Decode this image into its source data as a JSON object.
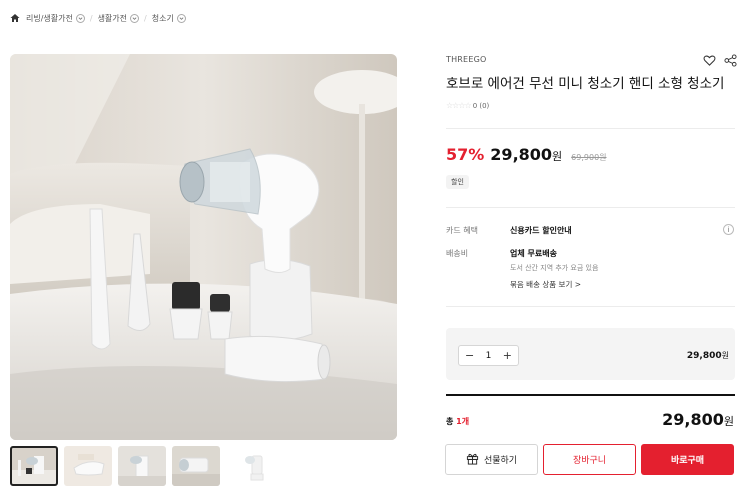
{
  "breadcrumb": {
    "items": [
      "리빙/생활가전",
      "생활가전",
      "청소기"
    ]
  },
  "product": {
    "brand": "THREEGO",
    "title": "호브로 에어건 무선 미니 청소기 핸디 소형 청소기",
    "rating_stars": "☆☆☆☆",
    "rating_text": "0 (0)",
    "discount": "57%",
    "price": "29,800",
    "currency": "원",
    "original_price": "69,900원",
    "sale_badge": "할인"
  },
  "info": {
    "card_label": "카드 혜택",
    "card_value": "신용카드 할인안내",
    "shipping_label": "배송비",
    "shipping_value": "업체 무료배송",
    "shipping_note": "도서 산간 지역 추가 요금 있음",
    "bundle_link": "묶음 배송 상품 보기 >"
  },
  "option": {
    "minus": "−",
    "qty": "1",
    "plus": "+",
    "price": "29,800",
    "currency": "원"
  },
  "total": {
    "prefix": "총 ",
    "count": "1개",
    "price": "29,800",
    "currency": "원"
  },
  "buttons": {
    "gift": "선물하기",
    "cart": "장바구니",
    "buy": "바로구매"
  },
  "colors": {
    "accent": "#e4202f"
  },
  "icons": [
    "home-icon",
    "chevron-down-icon",
    "heart-icon",
    "share-icon",
    "gift-icon",
    "info-icon"
  ]
}
